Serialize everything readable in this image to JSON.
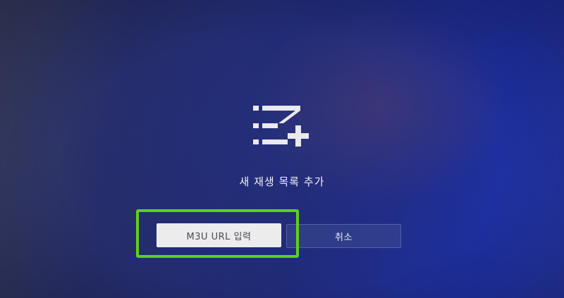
{
  "dialog": {
    "icon": "playlist-add-icon",
    "title": "새 재생 목록 추가",
    "buttons": {
      "m3u_label": "M3U URL 입력",
      "cancel_label": "취소"
    }
  },
  "colors": {
    "highlight": "#5cd11a",
    "focused_button_bg": "#ececed",
    "background_accent": "#1e2fa0"
  }
}
